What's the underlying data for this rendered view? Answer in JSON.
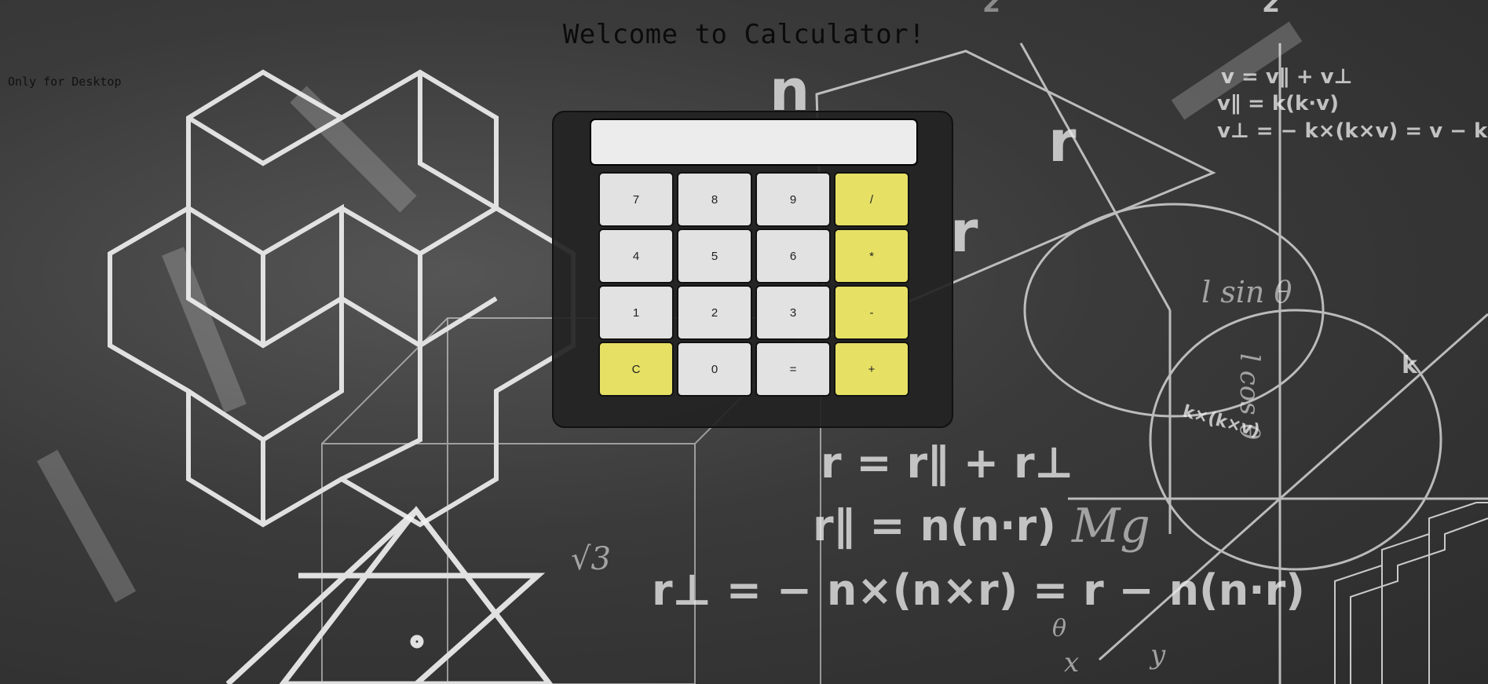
{
  "page": {
    "title": "Welcome to Calculator!",
    "notice": "Only for Desktop"
  },
  "calculator": {
    "display_value": "",
    "keys": [
      {
        "label": "7",
        "name": "key-7",
        "accent": false
      },
      {
        "label": "8",
        "name": "key-8",
        "accent": false
      },
      {
        "label": "9",
        "name": "key-9",
        "accent": false
      },
      {
        "label": "/",
        "name": "key-divide",
        "accent": true
      },
      {
        "label": "4",
        "name": "key-4",
        "accent": false
      },
      {
        "label": "5",
        "name": "key-5",
        "accent": false
      },
      {
        "label": "6",
        "name": "key-6",
        "accent": false
      },
      {
        "label": "*",
        "name": "key-multiply",
        "accent": true
      },
      {
        "label": "1",
        "name": "key-1",
        "accent": false
      },
      {
        "label": "2",
        "name": "key-2",
        "accent": false
      },
      {
        "label": "3",
        "name": "key-3",
        "accent": false
      },
      {
        "label": "-",
        "name": "key-subtract",
        "accent": true
      },
      {
        "label": "C",
        "name": "key-clear",
        "accent": true
      },
      {
        "label": "0",
        "name": "key-0",
        "accent": false
      },
      {
        "label": "=",
        "name": "key-equals",
        "accent": false
      },
      {
        "label": "+",
        "name": "key-add",
        "accent": true
      }
    ]
  },
  "background": {
    "formulas": [
      "v = v∥ + v⊥",
      "v∥ = k(k·v)",
      "v⊥ = − k×(k×v) = v − k(k·v)",
      "r = r∥ + r⊥",
      "r∥ = n(n·r)",
      "r⊥ = − n×(n×r) = r − n(n·r)",
      "Mg",
      "√3",
      "l sin θ",
      "l cos θ",
      "k×(k×v)"
    ]
  },
  "colors": {
    "accent_key": "#e6e164",
    "number_key": "#e2e2e2",
    "calculator_body": "#222222"
  }
}
